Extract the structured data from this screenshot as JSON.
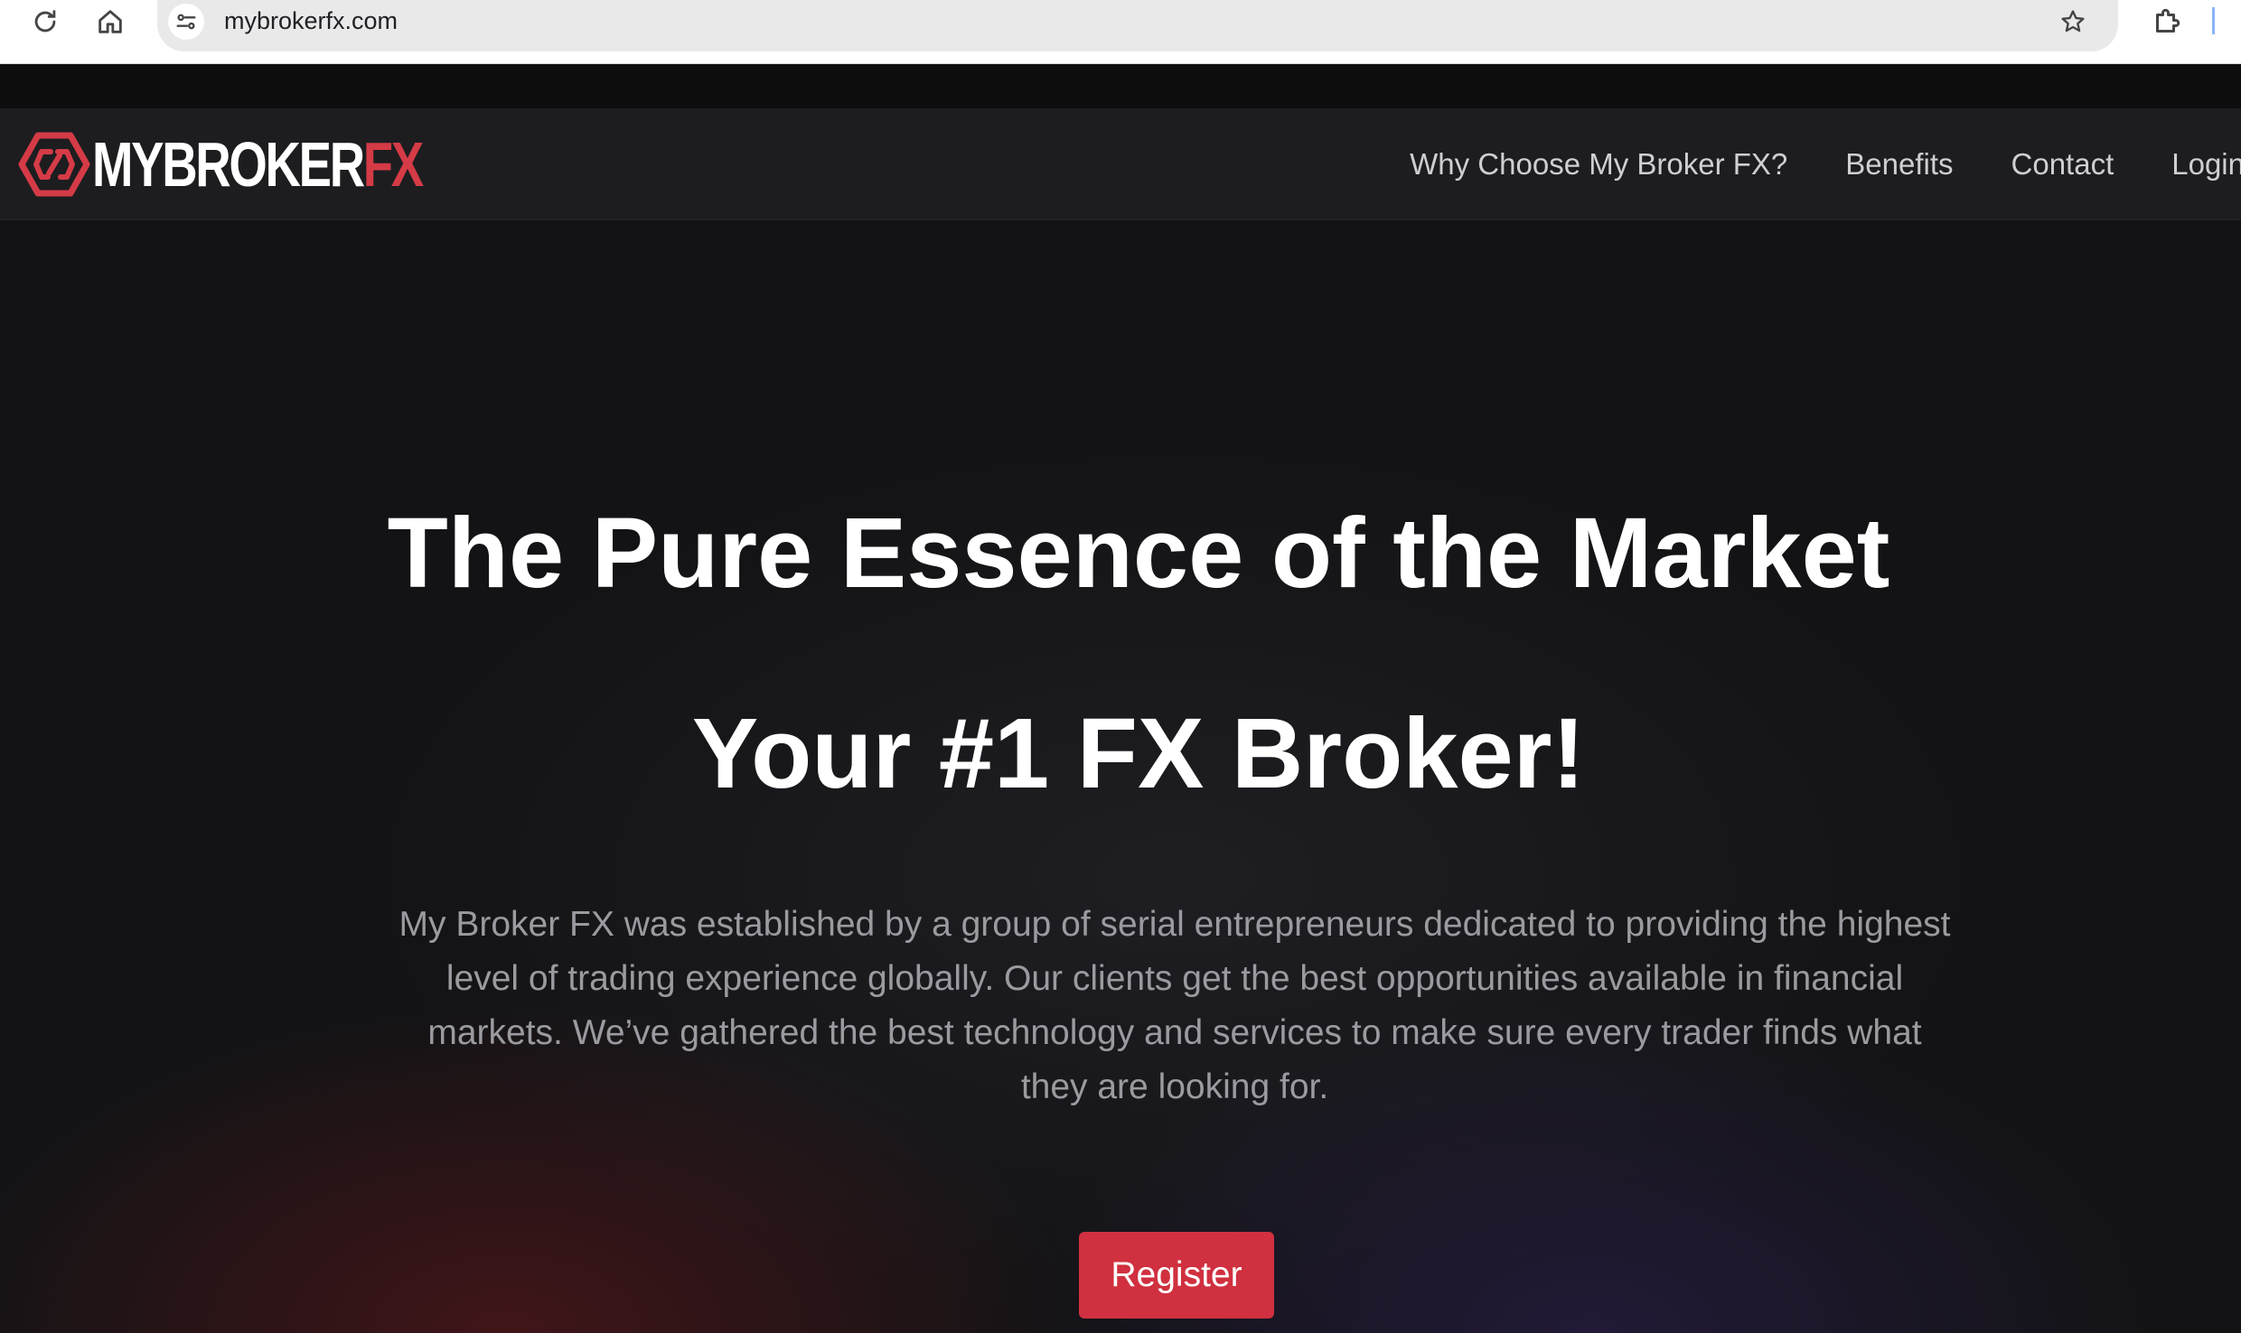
{
  "browser": {
    "url": "mybrokerfx.com",
    "icons": {
      "reload": "reload-icon",
      "home": "home-icon",
      "site_info": "site-settings-icon",
      "bookmark": "star-icon",
      "extensions": "puzzle-icon"
    }
  },
  "site": {
    "logo": {
      "main": "MYBROKER",
      "accent": "FX",
      "accent_color": "#d43b46"
    },
    "nav": [
      {
        "label": "Why Choose My Broker FX?"
      },
      {
        "label": "Benefits"
      },
      {
        "label": "Contact"
      },
      {
        "label": "Login"
      }
    ]
  },
  "hero": {
    "title_line1": "The Pure Essence of the Market",
    "title_line2": "Your #1 FX Broker!",
    "description": "My Broker FX was established by a group of serial entrepreneurs dedicated to providing the highest level of trading experience globally. Our clients get the best opportunities available in financial markets. We’ve gathered the best technology and services to make sure every trader finds what they are looking for.",
    "cta_label": "Register",
    "cta_color": "#d0303f"
  }
}
